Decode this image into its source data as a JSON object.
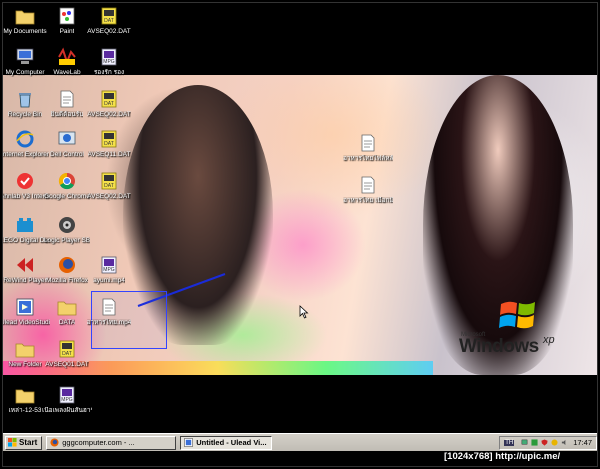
{
  "desktop_icons": [
    {
      "label": "My Documents",
      "icon": "folder-icon"
    },
    {
      "label": "Paint",
      "icon": "paint-icon"
    },
    {
      "label": "AVSEQ02.DAT",
      "icon": "dat-file-icon"
    },
    {
      "label": "My Computer",
      "icon": "computer-icon"
    },
    {
      "label": "WaveLab",
      "icon": "wavelab-icon"
    },
    {
      "label": "รองรัก รอง",
      "icon": "mpg-file-icon"
    },
    {
      "label": "Recycle Bin",
      "icon": "recycle-bin-icon"
    },
    {
      "label": "ยินดีต้อนรับ",
      "icon": "document-icon"
    },
    {
      "label": "AVSEQ02.DAT",
      "icon": "dat-file-icon"
    },
    {
      "label": "Internet Explorer",
      "icon": "ie-icon"
    },
    {
      "label": "Dell Control",
      "icon": "dell-icon"
    },
    {
      "label": "AVSEQ11.DAT",
      "icon": "dat-file-icon"
    },
    {
      "label": "Ahnlab V3 Internet Security",
      "icon": "ahnlab-icon"
    },
    {
      "label": "Google Chrome",
      "icon": "chrome-icon"
    },
    {
      "label": "AVSEQ02.DAT",
      "icon": "dat-file-icon"
    },
    {
      "label": "LEGO Digital Designer",
      "icon": "lego-icon"
    },
    {
      "label": "Logic Player SB",
      "icon": "logic-icon"
    },
    {
      "label": "ReWind Player",
      "icon": "rewind-icon"
    },
    {
      "label": "Mozilla Firefox",
      "icon": "firefox-icon"
    },
    {
      "label": "ayumi.mp4",
      "icon": "mpg-file-icon"
    },
    {
      "label": "Ulead VideoStudio",
      "icon": "ulead-icon"
    },
    {
      "label": "DATA",
      "icon": "folder-icon"
    },
    {
      "label": "อาหารไทย.mp4",
      "icon": "document-icon"
    },
    {
      "label": "New Folder",
      "icon": "folder-icon"
    },
    {
      "label": "AVSEQ01.DAT",
      "icon": "dat-file-icon"
    },
    {
      "label": "อาหารไทยไฟล์หลัก.wav",
      "icon": "document-icon"
    },
    {
      "label": "อาหารไทย เมือกมิก.wav",
      "icon": "document-icon"
    },
    {
      "label": "เหล่า-12-53",
      "icon": "folder-icon"
    },
    {
      "label": "เนื้อเพลงฝันสั้นฮาร์ทีบนเนินดิน",
      "icon": "mpg-file-icon"
    }
  ],
  "logo": {
    "brand_small": "Microsoft",
    "brand_word": "Windows",
    "brand_suffix": "xp"
  },
  "taskbar": {
    "start_label": "Start",
    "tasks": [
      {
        "label": "gggcomputer.com - ...",
        "icon": "firefox-icon",
        "active": false
      },
      {
        "label": "Untitled - Ulead Vi...",
        "icon": "ulead-icon",
        "active": true
      }
    ],
    "language": "TH",
    "clock": "17:47"
  },
  "footer_text": "[1024x768] http://upic.me/",
  "colors": {
    "selection": "#3344ff",
    "taskbar": "#d4d0c8",
    "desktop": "#000000"
  }
}
